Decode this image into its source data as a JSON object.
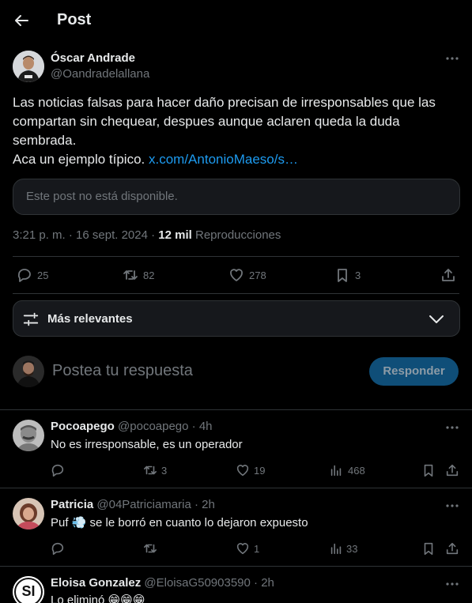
{
  "header": {
    "title": "Post",
    "back_icon": "arrow-left-icon"
  },
  "post": {
    "author_name": "Óscar Andrade",
    "author_handle": "@Oandradelallana",
    "text_line1": "Las noticias falsas para hacer daño precisan de irresponsables que las",
    "text_line2": "compartan sin chequear, despues aunque aclaren queda la duda",
    "text_line3": "sembrada.",
    "text_line4": "Aca un ejemplo típico.",
    "link": "x.com/AntonioMaeso/s…",
    "unavailable": "Este post no está disponible.",
    "time": "3:21 p. m. · 16 sept. 2024 ·",
    "views": "12 mil",
    "views_label": "Reproducciones",
    "replies": "25",
    "reposts": "82",
    "likes": "278",
    "bookmarks": "3"
  },
  "sort": {
    "label": "Más relevantes",
    "icon": "sliders-icon"
  },
  "composer": {
    "placeholder": "Postea tu respuesta",
    "button": "Responder"
  },
  "replies": [
    {
      "name": "Pocoapego",
      "handle": "@pocoapego",
      "time": "· 4h",
      "text": "No es irresponsable, es un operador",
      "reposts": "3",
      "likes": "19",
      "views": "468"
    },
    {
      "name": "Patricia",
      "handle": "@04Patriciamaria",
      "time": "· 2h",
      "text_before": "Puf",
      "emoji": "💨",
      "text_after": "se le borró en cuanto lo dejaron expuesto",
      "likes": "1",
      "views": "33"
    },
    {
      "name": "Eloisa Gonzalez",
      "handle": "@EloisaG50903590",
      "time": "· 2h",
      "text": "Lo eliminó",
      "emoji": "😁😁😁",
      "avatar_text": "SI"
    }
  ],
  "colors": {
    "accent": "#1d9bf0",
    "muted": "#71767b",
    "text": "#e7e9ea",
    "border": "#2f3336",
    "button": "#0f4e78"
  }
}
